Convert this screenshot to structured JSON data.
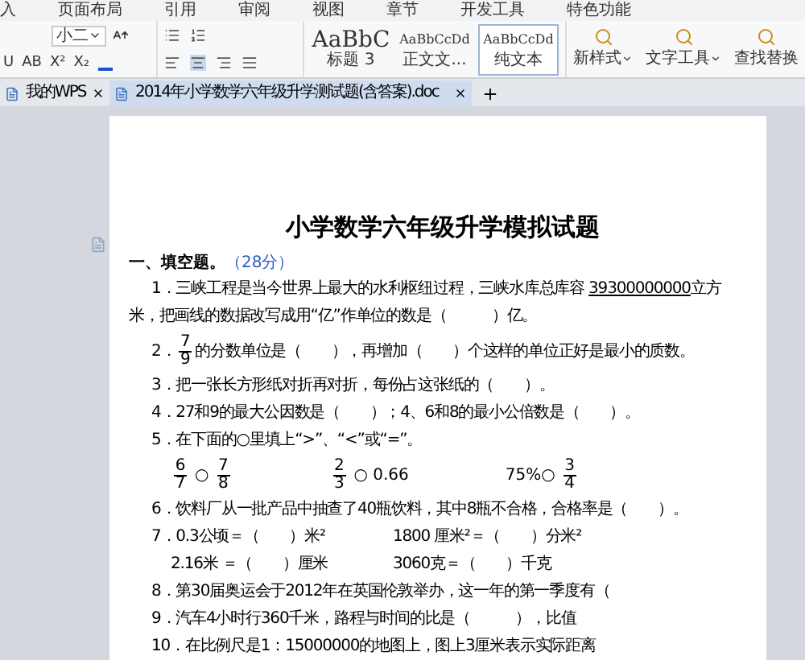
{
  "menu_tabs": [
    "入",
    "页面布局",
    "引用",
    "审阅",
    "视图",
    "章节",
    "开发工具",
    "特色功能"
  ],
  "toolbar": {
    "font_size": "小二",
    "format_buttons": [
      "U",
      "AB",
      "X²",
      "X₂"
    ],
    "styles": [
      {
        "preview": "AaBbC",
        "label": "标题 3",
        "selected": false
      },
      {
        "preview": "AaBbCcDd",
        "label": "正文文...",
        "selected": false
      },
      {
        "preview": "AaBbCcDd",
        "label": "纯文本",
        "selected": true
      }
    ],
    "tools": [
      "新样式",
      "文字工具",
      "查找替换"
    ]
  },
  "doc_tabs": [
    {
      "label": "我的WPS",
      "selected": false
    },
    {
      "label": "2014年小学数学六年级升学测试题(含答案).doc",
      "selected": true
    }
  ],
  "document": {
    "title": "小学数学六年级升学模拟试题",
    "section": {
      "label": "一、填空题。",
      "score": "（28分）"
    },
    "lines": [
      {
        "kind": "underline",
        "before": "1．三峡工程是当今世界上最大的水利枢纽过程，三峡水库总库容 ",
        "underlined": "39300000000",
        "after": "立方"
      },
      {
        "kind": "plain",
        "text": "米，把画线的数据改写成用“亿”作单位的数是（　　　）亿。"
      },
      {
        "kind": "fraction",
        "prefix": "2．",
        "num": "7",
        "den": "9",
        "text": "的分数单位是（　　），再增加（　　）个这样的单位正好是最小的质数。"
      },
      {
        "kind": "text",
        "text": "3．把一张长方形纸对折再对折，每份占这张纸的（　　）。"
      },
      {
        "kind": "text",
        "text": "4．27和9的最大公因数是（　　）；4、6和8的最小公倍数是（　　）。"
      },
      {
        "kind": "text",
        "text": "5．在下面的○里填上“>”、“<”或“=”。"
      },
      {
        "kind": "compare",
        "items": [
          [
            {
              "num": "6",
              "den": "7"
            },
            {
              "text": "○"
            },
            {
              "num": "7",
              "den": "8"
            }
          ],
          [
            {
              "num": "2",
              "den": "3"
            },
            {
              "text": "○ 0.66"
            }
          ],
          [
            {
              "text": "75%○"
            },
            {
              "num": "3",
              "den": "4"
            }
          ]
        ]
      },
      {
        "kind": "text",
        "text": "6．饮料厂从一批产品中抽查了40瓶饮料，其中8瓶不合格，合格率是（　　）。"
      },
      {
        "kind": "columns",
        "cells": [
          "7．0.3公顷＝（　　）米²",
          "1800 厘米²＝（　　）分米²"
        ]
      },
      {
        "kind": "columns",
        "cells": [
          "2.16米 ＝（　　）厘米",
          "3060克＝（　　）千克"
        ],
        "indent": true
      },
      {
        "kind": "text",
        "text": "8．第30届奥运会于2012年在英国伦敦举办，这一年的第一季度有（"
      },
      {
        "kind": "text",
        "text": "9．汽车4小时行360千米，路程与时间的比是（　　　），比值"
      },
      {
        "kind": "text",
        "text": "10．在比例尺是1：15000000的地图上，图上3厘米表示实际距离"
      }
    ]
  }
}
